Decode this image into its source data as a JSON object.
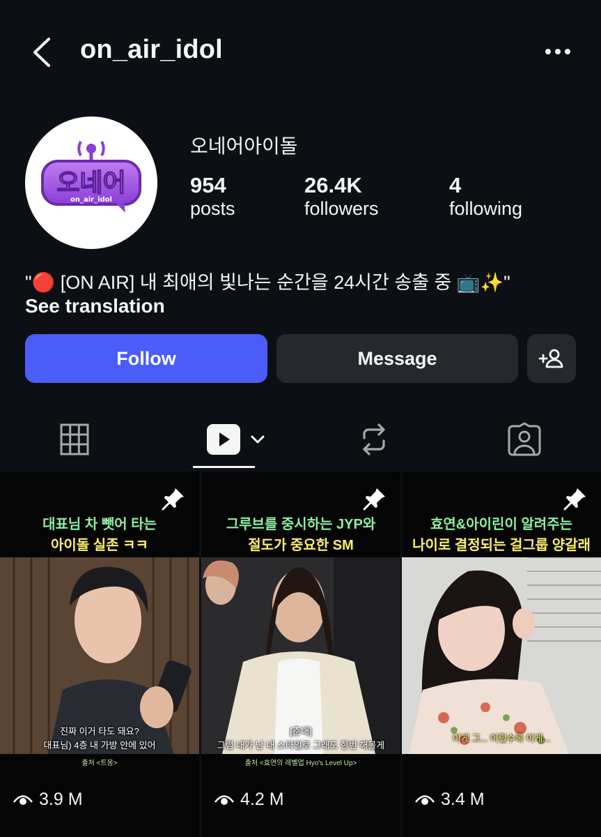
{
  "header": {
    "username": "on_air_idol"
  },
  "profile": {
    "avatar_logo_text": "오네어",
    "avatar_logo_subtext": "on_air_idol",
    "display_name": "오네어아이돌",
    "stats": [
      {
        "value": "954",
        "label": "posts"
      },
      {
        "value": "26.4K",
        "label": "followers"
      },
      {
        "value": "4",
        "label": "following"
      }
    ],
    "bio": "\"🔴 [ON AIR] 내 최애의 빛나는 순간을 24시간 송출 중 📺✨\"",
    "see_translation": "See translation"
  },
  "actions": {
    "follow_label": "Follow",
    "message_label": "Message"
  },
  "tabs": [
    {
      "icon": "grid-icon",
      "active": false
    },
    {
      "icon": "reels-icon",
      "active": true
    },
    {
      "icon": "reposts-icon",
      "active": false
    },
    {
      "icon": "tagged-icon",
      "active": false
    }
  ],
  "reels": [
    {
      "caption_line1": "대표님 차 뺏어 타는",
      "caption_line2": "아이돌 실존 ㅋㅋ",
      "subtitle_line1": "진짜 이거 타도 돼요?",
      "subtitle_line2": "대표님) 4층 내 가방 안에 있어",
      "credit": "출처 <트몽>",
      "views": "3.9 M",
      "pinned": true
    },
    {
      "caption_line1": "그루브를 중시하는 JYP와",
      "caption_line2": "절도가 중요한 SM",
      "subtitle_line1": "[춘대]",
      "subtitle_line2": "그럼 내가 난 내 스타일로 그래도 한번 해볼게",
      "credit": "출처 <효연의 레벨업 Hyo's Level Up>",
      "views": "4.2 M",
      "pinned": true
    },
    {
      "caption_line1": "효연&아이린이 알려주는",
      "caption_line2": "나이로 결정되는 걸그룹 양갈래",
      "subtitle_line1": "이게 그... 어릴수록 이게...",
      "subtitle_line2": "",
      "credit": "",
      "views": "3.4 M",
      "pinned": true
    }
  ],
  "colors": {
    "background": "#0c1014",
    "follow_button": "#4a5df9",
    "secondary_button": "#25292e",
    "caption_green": "#8bf0a0",
    "caption_yellow": "#fff06a"
  }
}
